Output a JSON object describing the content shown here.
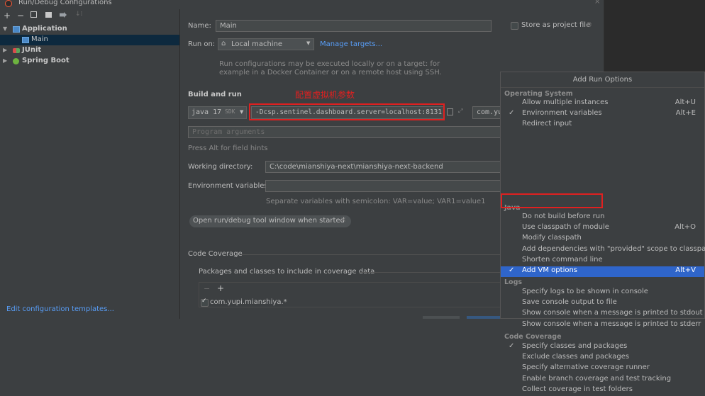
{
  "window": {
    "title": "Run/Debug Configurations"
  },
  "toolbar": {
    "icons": [
      "add-icon",
      "remove-icon",
      "copy-icon",
      "save-icon",
      "move-icon",
      "sort-icon"
    ]
  },
  "tree": {
    "items": [
      {
        "label": "Application"
      },
      {
        "label": "Main"
      },
      {
        "label": "JUnit"
      },
      {
        "label": "Spring Boot"
      }
    ],
    "edit_templates": "Edit configuration templates..."
  },
  "form": {
    "name_label": "Name:",
    "name_value": "Main",
    "store_label": "Store as project file",
    "run_on_label": "Run on:",
    "run_on_value": "Local machine",
    "manage_targets": "Manage targets...",
    "run_hint_1": "Run configurations may be executed locally or on a target: for",
    "run_hint_2": "example in a Docker Container or on a remote host using SSH.",
    "build_run_label": "Build and run",
    "annotation": "配置虚拟机参数",
    "jdk_value": "java 17",
    "jdk_suffix": "SDK",
    "vm_options_value": "-Dcsp.sentinel.dashboard.server=localhost:8131",
    "main_class_value": "com.yu",
    "program_args_placeholder": "Program arguments",
    "alt_hint": "Press Alt for field hints",
    "workdir_label": "Working directory:",
    "workdir_value": "C:\\code\\mianshiya-next\\mianshiya-next-backend",
    "env_label": "Environment variables:",
    "env_value": "",
    "env_hint": "Separate variables with semicolon: VAR=value; VAR1=value1",
    "open_tool_window_tag": "Open run/debug tool window when started",
    "code_coverage_label": "Code Coverage",
    "packages_label": "Packages and classes to include in coverage data",
    "coverage_item": "com.yupi.mianshiya.*"
  },
  "dropdown": {
    "title": "Add Run Options",
    "sections": [
      {
        "name": "Operating System",
        "items": [
          {
            "label": "Allow multiple instances",
            "shortcut": "Alt+U",
            "checked": false
          },
          {
            "label": "Environment variables",
            "shortcut": "Alt+E",
            "checked": true
          },
          {
            "label": "Redirect input",
            "shortcut": "",
            "checked": false
          }
        ]
      },
      {
        "name": "Java",
        "items": [
          {
            "label": "Do not build before run",
            "shortcut": "",
            "checked": false
          },
          {
            "label": "Use classpath of module",
            "shortcut": "Alt+O",
            "checked": false
          },
          {
            "label": "Modify classpath",
            "shortcut": "",
            "checked": false
          },
          {
            "label": "Add dependencies with \"provided\" scope to classpath",
            "shortcut": "",
            "checked": false
          },
          {
            "label": "Shorten command line",
            "shortcut": "",
            "checked": false
          },
          {
            "label": "Add VM options",
            "shortcut": "Alt+V",
            "checked": true,
            "selected": true
          }
        ]
      },
      {
        "name": "Logs",
        "items": [
          {
            "label": "Specify logs to be shown in console",
            "shortcut": "",
            "checked": false
          },
          {
            "label": "Save console output to file",
            "shortcut": "",
            "checked": false
          },
          {
            "label": "Show console when a message is printed to stdout",
            "shortcut": "",
            "checked": false
          },
          {
            "label": "Show console when a message is printed to stderr",
            "shortcut": "",
            "checked": false
          }
        ]
      },
      {
        "name": "Code Coverage",
        "items": [
          {
            "label": "Specify classes and packages",
            "shortcut": "",
            "checked": true
          },
          {
            "label": "Exclude classes and packages",
            "shortcut": "",
            "checked": false
          },
          {
            "label": "Specify alternative coverage runner",
            "shortcut": "",
            "checked": false
          },
          {
            "label": "Enable branch coverage and test tracking",
            "shortcut": "",
            "checked": false
          },
          {
            "label": "Collect coverage in test folders",
            "shortcut": "",
            "checked": false
          }
        ]
      }
    ],
    "check_glyph": "✓"
  },
  "colors": {
    "accent": "#589df6",
    "selection": "#2f65ca",
    "highlight_box": "#e02020",
    "background": "#3c3f41"
  }
}
